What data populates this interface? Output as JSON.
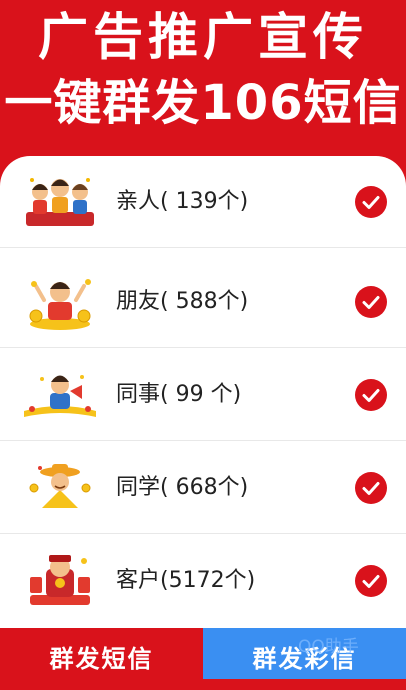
{
  "header": {
    "title_line1": "广告推广宣传",
    "title_line2": "一键群发106短信"
  },
  "contacts": [
    {
      "label": "亲人( 139个)",
      "icon": "family-icon",
      "checked": true
    },
    {
      "label": "朋友( 588个)",
      "icon": "friend-icon",
      "checked": true
    },
    {
      "label": "同事(  99 个)",
      "icon": "colleague-icon",
      "checked": true
    },
    {
      "label": "同学( 668个)",
      "icon": "classmate-icon",
      "checked": true
    },
    {
      "label": "客户(5172个)",
      "icon": "customer-icon",
      "checked": true
    }
  ],
  "bottom": {
    "sms_label": "群发短信",
    "mms_label": "群发彩信",
    "watermark": "QQ助手"
  },
  "colors": {
    "brand_red": "#d9121b",
    "mms_blue": "#3a8ff2"
  }
}
